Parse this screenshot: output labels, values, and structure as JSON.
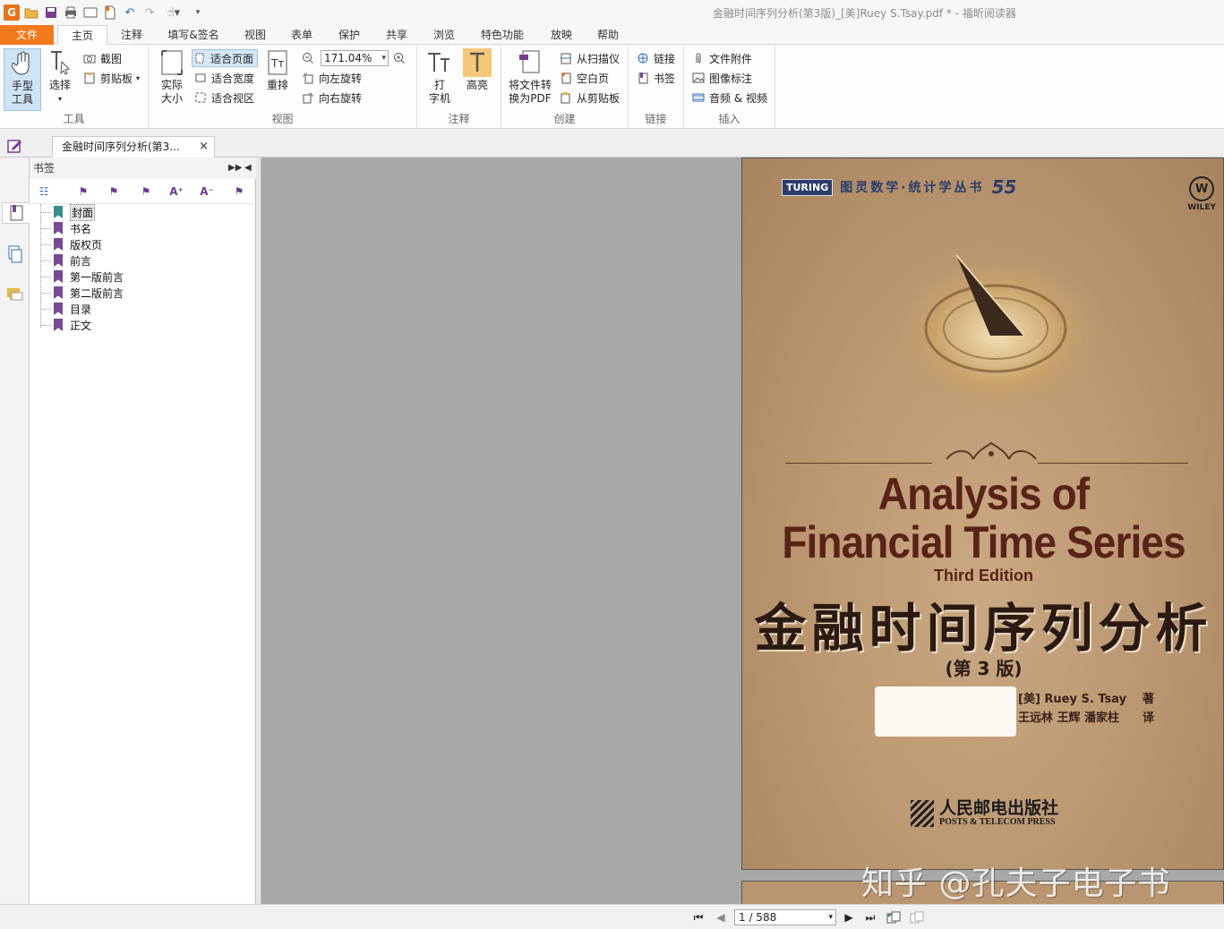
{
  "window": {
    "title": "金融时间序列分析(第3版)_[美]Ruey S.Tsay.pdf * - 福昕阅读器"
  },
  "menu": {
    "tabs": [
      "文件",
      "主页",
      "注释",
      "填写&签名",
      "视图",
      "表单",
      "保护",
      "共享",
      "浏览",
      "特色功能",
      "放映",
      "帮助"
    ],
    "active": "主页"
  },
  "ribbon": {
    "tools": {
      "title": "工具",
      "hand": "手型\n工具",
      "select": "选择",
      "screenshot": "截图",
      "clipboard": "剪贴板"
    },
    "view": {
      "title": "视图",
      "actual_size": "实际\n大小",
      "fit_page": "适合页面",
      "fit_width": "适合宽度",
      "fit_visible": "适合视区",
      "reflow": "重排",
      "zoom": "171.04%",
      "rotate_left": "向左旋转",
      "rotate_right": "向右旋转"
    },
    "annotate": {
      "title": "注释",
      "typewriter": "打\n字机",
      "highlight": "高亮"
    },
    "create": {
      "title": "创建",
      "convert": "将文件转\n换为PDF",
      "from_scanner": "从扫描仪",
      "blank_page": "空白页",
      "from_clipboard": "从剪贴板"
    },
    "links": {
      "title": "链接",
      "link": "链接",
      "bookmark": "书签"
    },
    "insert": {
      "title": "插入",
      "attachment": "文件附件",
      "image_annot": "图像标注",
      "audio_video": "音频 & 视频"
    }
  },
  "doc_tab": {
    "label": "金融时间序列分析(第3...",
    "close": "×"
  },
  "bookmarks": {
    "title": "书签",
    "items": [
      "封面",
      "书名",
      "版权页",
      "前言",
      "第一版前言",
      "第二版前言",
      "目录",
      "正文"
    ],
    "selected_index": 0
  },
  "cover": {
    "publisher_brand": "TURING",
    "series": "图灵数学·统计学丛书",
    "series_number": "55",
    "wiley": "WILEY",
    "title_line1": "Analysis of",
    "title_line2": "Financial Time Series",
    "edition": "Third Edition",
    "cn_title": "金融时间序列分析",
    "cn_edition": "(第 3 版)",
    "author_row": {
      "name": "[美] Ruey S. Tsay",
      "role": "著"
    },
    "translator_row": {
      "name": "王远林 王辉 潘家柱",
      "role": "译"
    },
    "press_cn": "人民邮电出版社",
    "press_en": "POSTS & TELECOM PRESS"
  },
  "watermark": "知乎 @孔夫子电子书",
  "status": {
    "page_indicator": "1 / 588"
  },
  "colors": {
    "accent_orange": "#f27a1d",
    "bookmark_purple": "#7a4a93",
    "viewer_bg": "#a8a8a8"
  }
}
